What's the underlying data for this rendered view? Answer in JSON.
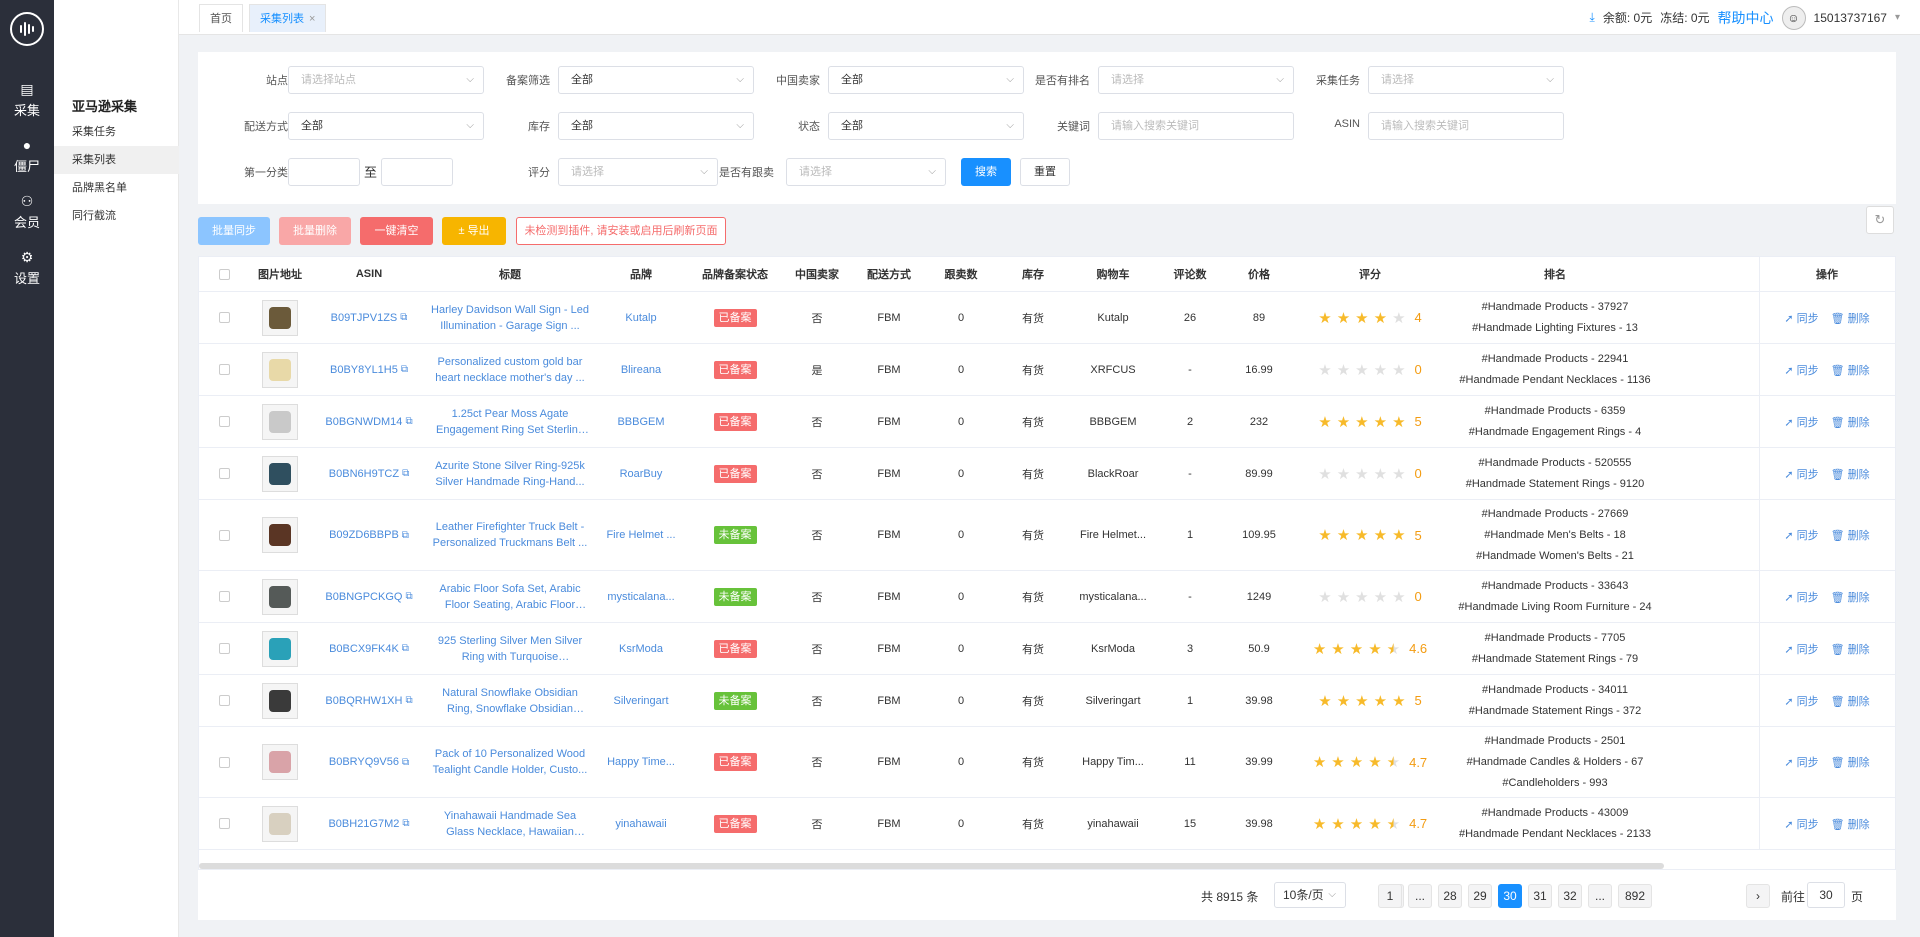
{
  "rail": {
    "items": [
      {
        "label": "采集",
        "icon": "collect-icon"
      },
      {
        "label": "僵尸",
        "icon": "zombie-icon"
      },
      {
        "label": "会员",
        "icon": "user-icon"
      },
      {
        "label": "设置",
        "icon": "settings-icon"
      }
    ]
  },
  "sidebar": {
    "title": "亚马逊采集",
    "items": [
      "采集任务",
      "采集列表",
      "品牌黑名单",
      "同行截流"
    ]
  },
  "tabs": {
    "home": "首页",
    "list": "采集列表",
    "close": "×"
  },
  "topbar": {
    "balance": "余额: 0元",
    "frozen": "冻结: 0元",
    "help": "帮助中心",
    "phone": "15013737167"
  },
  "filters": {
    "site_label": "站点",
    "site_value": "请选择站点",
    "record_label": "备案筛选",
    "record_value": "全部",
    "china_label": "中国卖家",
    "china_value": "全部",
    "rank_label": "是否有排名",
    "rank_value": "请选择",
    "task_label": "采集任务",
    "task_value": "请选择",
    "ship_label": "配送方式",
    "ship_value": "全部",
    "stock_label": "库存",
    "stock_value": "全部",
    "status_label": "状态",
    "status_value": "全部",
    "kw_label": "关键词",
    "kw_placeholder": "请输入搜索关键词",
    "asin_label": "ASIN",
    "asin_placeholder": "请输入搜索关键词",
    "cat_label": "第一分类",
    "cat_to": "至",
    "score_label": "评分",
    "score_value": "请选择",
    "follow_label": "是否有跟卖",
    "follow_value": "请选择",
    "search_btn": "搜索",
    "reset_btn": "重置"
  },
  "actions": {
    "sync": "批量同步",
    "delete": "批量删除",
    "clear": "一键清空",
    "export": "± 导出",
    "warning": "未检测到插件, 请安装或启用后刷新页面"
  },
  "columns": [
    "图片地址",
    "ASIN",
    "标题",
    "品牌",
    "品牌备案状态",
    "中国卖家",
    "配送方式",
    "跟卖数",
    "库存",
    "购物车",
    "评论数",
    "价格",
    "评分",
    "排名",
    "操作"
  ],
  "colors": {
    "primary": "#1890ff",
    "registered": "#f56c6c",
    "unregistered": "#67c23a",
    "star": "#f7ba2a"
  },
  "rows": [
    {
      "asin": "B09TJPV1ZS",
      "title": "Harley Davidson Wall Sign - Led Illumination - Garage Sign ...",
      "brand": "Kutalp",
      "status": "已备案",
      "china": "否",
      "ship": "FBM",
      "follow": "0",
      "stock": "有货",
      "cart": "Kutalp",
      "reviews": "26",
      "price": "89",
      "rating": 4,
      "score": "4",
      "rank": [
        "#Handmade Products - 37927",
        "#Handmade Lighting Fixtures - 13"
      ],
      "thumb": "#6b5a3a"
    },
    {
      "asin": "B0BY8YL1H5",
      "title": "Personalized custom gold bar heart necklace mother's day ...",
      "brand": "Blireana",
      "status": "已备案",
      "china": "是",
      "ship": "FBM",
      "follow": "0",
      "stock": "有货",
      "cart": "XRFCUS",
      "reviews": "-",
      "price": "16.99",
      "rating": 0,
      "score": "0",
      "rank": [
        "#Handmade Products - 22941",
        "#Handmade Pendant Necklaces - 1136"
      ],
      "thumb": "#e8d9a8"
    },
    {
      "asin": "B0BGNWDM14",
      "title": "1.25ct Pear Moss Agate Engagement Ring Set Sterling Silver...",
      "brand": "BBBGEM",
      "status": "已备案",
      "china": "否",
      "ship": "FBM",
      "follow": "0",
      "stock": "有货",
      "cart": "BBBGEM",
      "reviews": "2",
      "price": "232",
      "rating": 5,
      "score": "5",
      "rank": [
        "#Handmade Products - 6359",
        "#Handmade Engagement Rings - 4"
      ],
      "thumb": "#c9c9c9"
    },
    {
      "asin": "B0BN6H9TCZ",
      "title": "Azurite Stone Silver Ring-925k Silver Handmade Ring-Hand...",
      "brand": "RoarBuy",
      "status": "已备案",
      "china": "否",
      "ship": "FBM",
      "follow": "0",
      "stock": "有货",
      "cart": "BlackRoar",
      "reviews": "-",
      "price": "89.99",
      "rating": 0,
      "score": "0",
      "rank": [
        "#Handmade Products - 520555",
        "#Handmade Statement Rings - 9120"
      ],
      "thumb": "#2f4f5f"
    },
    {
      "asin": "B09ZD6BBPB",
      "title": "Leather Firefighter Truck Belt - Personalized Truckmans Belt ...",
      "brand": "Fire Helmet ...",
      "status": "未备案",
      "china": "否",
      "ship": "FBM",
      "follow": "0",
      "stock": "有货",
      "cart": "Fire Helmet...",
      "reviews": "1",
      "price": "109.95",
      "rating": 5,
      "score": "5",
      "rank": [
        "#Handmade Products - 27669",
        "#Handmade Men's Belts - 18",
        "#Handmade Women's Belts - 21"
      ],
      "thumb": "#5a3524"
    },
    {
      "asin": "B0BNGPCKGQ",
      "title": "Arabic Floor Sofa Set, Arabic Floor Seating, Arabic Floor Sof...",
      "brand": "mysticalana...",
      "status": "未备案",
      "china": "否",
      "ship": "FBM",
      "follow": "0",
      "stock": "有货",
      "cart": "mysticalana...",
      "reviews": "-",
      "price": "1249",
      "rating": 0,
      "score": "0",
      "rank": [
        "#Handmade Products - 33643",
        "#Handmade Living Room Furniture - 24"
      ],
      "thumb": "#555a58"
    },
    {
      "asin": "B0BCX9FK4K",
      "title": "925 Sterling Silver Men Silver Ring with Turquoise GemStone...",
      "brand": "KsrModa",
      "status": "已备案",
      "china": "否",
      "ship": "FBM",
      "follow": "0",
      "stock": "有货",
      "cart": "KsrModa",
      "reviews": "3",
      "price": "50.9",
      "rating": 4.6,
      "score": "4.6",
      "rank": [
        "#Handmade Products - 7705",
        "#Handmade Statement Rings - 79"
      ],
      "thumb": "#2aa1b8"
    },
    {
      "asin": "B0BQRHW1XH",
      "title": "Natural Snowflake Obsidian Ring, Snowflake Obsidian Ring,...",
      "brand": "Silveringart",
      "status": "未备案",
      "china": "否",
      "ship": "FBM",
      "follow": "0",
      "stock": "有货",
      "cart": "Silveringart",
      "reviews": "1",
      "price": "39.98",
      "rating": 5,
      "score": "5",
      "rank": [
        "#Handmade Products - 34011",
        "#Handmade Statement Rings - 372"
      ],
      "thumb": "#3a3a3a"
    },
    {
      "asin": "B0BRYQ9V56",
      "title": "Pack of 10 Personalized Wood Tealight Candle Holder, Custo...",
      "brand": "Happy Time...",
      "status": "已备案",
      "china": "否",
      "ship": "FBM",
      "follow": "0",
      "stock": "有货",
      "cart": "Happy Tim...",
      "reviews": "11",
      "price": "39.99",
      "rating": 4.7,
      "score": "4.7",
      "rank": [
        "#Handmade Products - 2501",
        "#Handmade Candles & Holders - 67",
        "#Candleholders - 993"
      ],
      "thumb": "#d9a3a8"
    },
    {
      "asin": "B0BH21G7M2",
      "title": "Yinahawaii Handmade Sea Glass Necklace, Hawaiian Jewelry ...",
      "brand": "yinahawaii",
      "status": "已备案",
      "china": "否",
      "ship": "FBM",
      "follow": "0",
      "stock": "有货",
      "cart": "yinahawaii",
      "reviews": "15",
      "price": "39.98",
      "rating": 4.7,
      "score": "4.7",
      "rank": [
        "#Handmade Products - 43009",
        "#Handmade Pendant Necklaces - 2133"
      ],
      "thumb": "#d8d0c0"
    }
  ],
  "ops": {
    "sync": "同步",
    "delete": "删除"
  },
  "pagination": {
    "total": "共 8915 条",
    "page_size": "10条/页",
    "pages": [
      "1",
      "...",
      "28",
      "29",
      "30",
      "31",
      "32",
      "...",
      "892"
    ],
    "current": "30",
    "goto_label": "前往",
    "goto_value": "30",
    "goto_suffix": "页"
  }
}
